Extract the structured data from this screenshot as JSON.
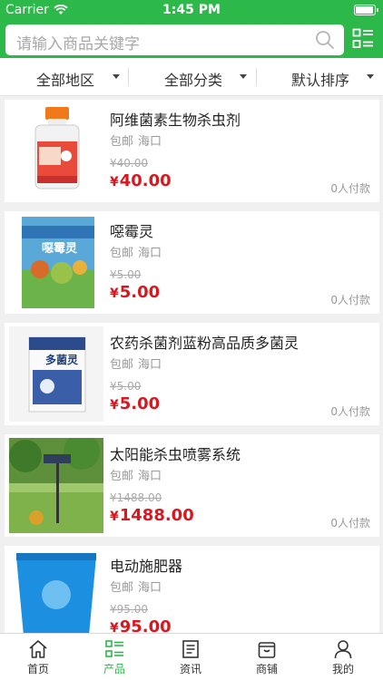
{
  "status_bar": {
    "carrier": "Carrier",
    "time": "1:45 PM"
  },
  "search": {
    "placeholder": "请输入商品关键字"
  },
  "filters": [
    {
      "label": "全部地区"
    },
    {
      "label": "全部分类"
    },
    {
      "label": "默认排序"
    }
  ],
  "products": [
    {
      "title": "阿维菌素生物杀虫剂",
      "tags": [
        "包邮",
        "海口"
      ],
      "old_price": "¥40.00",
      "currency": "¥",
      "price": "40.00",
      "paid": "0人付款"
    },
    {
      "title": "噁霉灵",
      "tags": [
        "包邮",
        "海口"
      ],
      "old_price": "¥5.00",
      "currency": "¥",
      "price": "5.00",
      "paid": "0人付款",
      "package_text": "噁霉灵"
    },
    {
      "title": "农药杀菌剂蓝粉高品质多菌灵",
      "tags": [
        "包邮",
        "海口"
      ],
      "old_price": "¥5.00",
      "currency": "¥",
      "price": "5.00",
      "paid": "0人付款",
      "package_text": "多菌灵"
    },
    {
      "title": "太阳能杀虫喷雾系统",
      "tags": [
        "包邮",
        "海口"
      ],
      "old_price": "¥1488.00",
      "currency": "¥",
      "price": "1488.00",
      "paid": "0人付款"
    },
    {
      "title": "电动施肥器",
      "tags": [
        "包邮",
        "海口"
      ],
      "old_price": "¥95.00",
      "currency": "¥",
      "price": "95.00",
      "paid": ""
    }
  ],
  "tabbar": [
    {
      "label": "首页",
      "icon": "home-icon"
    },
    {
      "label": "产品",
      "icon": "product-list-icon",
      "active": true
    },
    {
      "label": "资讯",
      "icon": "news-icon"
    },
    {
      "label": "商铺",
      "icon": "shop-icon"
    },
    {
      "label": "我的",
      "icon": "user-icon"
    }
  ],
  "colors": {
    "brand": "#2db84a",
    "price": "#d9171f"
  }
}
